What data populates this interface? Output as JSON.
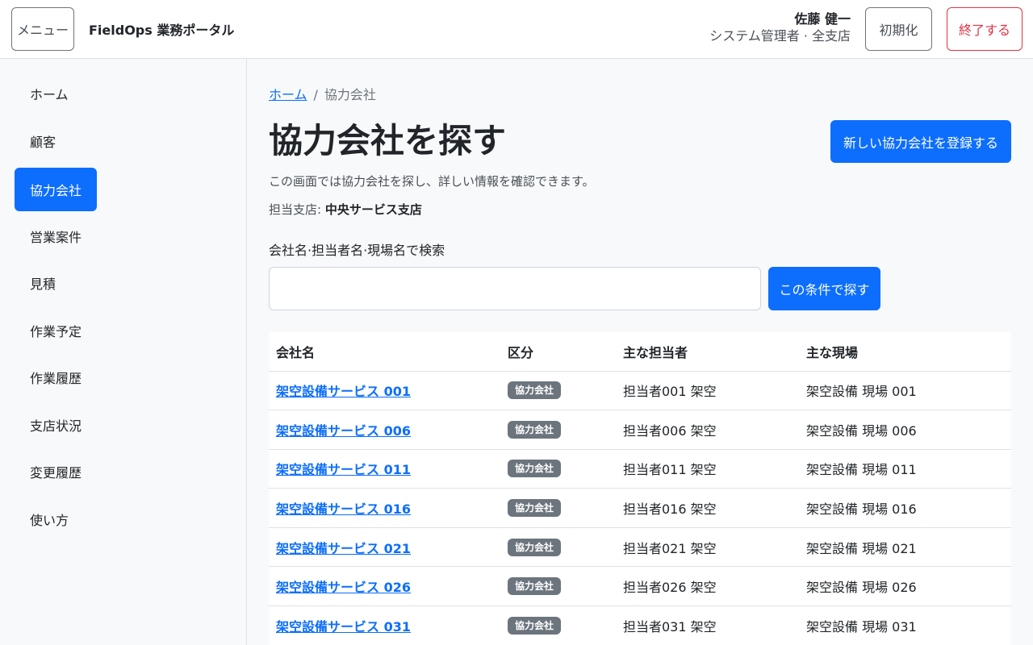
{
  "header": {
    "menu_label": "メニュー",
    "app_title": "FieldOps 業務ポータル",
    "user_name": "佐藤 健一",
    "user_role": "システム管理者 · 全支店",
    "reset_label": "初期化",
    "logout_label": "終了する"
  },
  "sidebar": {
    "items": [
      {
        "label": "ホーム",
        "active": false
      },
      {
        "label": "顧客",
        "active": false
      },
      {
        "label": "協力会社",
        "active": true
      },
      {
        "label": "営業案件",
        "active": false
      },
      {
        "label": "見積",
        "active": false
      },
      {
        "label": "作業予定",
        "active": false
      },
      {
        "label": "作業履歴",
        "active": false
      },
      {
        "label": "支店状況",
        "active": false
      },
      {
        "label": "変更履歴",
        "active": false
      },
      {
        "label": "使い方",
        "active": false
      }
    ]
  },
  "breadcrumb": {
    "home": "ホーム",
    "separator": "/",
    "current": "協力会社"
  },
  "page": {
    "title": "協力会社を探す",
    "description": "この画面では協力会社を探し、詳しい情報を確認できます。",
    "branch_label": "担当支店:",
    "branch_value": "中央サービス支店",
    "register_label": "新しい協力会社を登録する"
  },
  "search": {
    "label": "会社名·担当者名·現場名で検索",
    "value": "",
    "placeholder": "",
    "button_label": "この条件で探す"
  },
  "table": {
    "columns": [
      "会社名",
      "区分",
      "主な担当者",
      "主な現場"
    ],
    "rows": [
      {
        "company": "架空設備サービス 001",
        "category": "協力会社",
        "contact": "担当者001 架空",
        "site": "架空設備 現場 001"
      },
      {
        "company": "架空設備サービス 006",
        "category": "協力会社",
        "contact": "担当者006 架空",
        "site": "架空設備 現場 006"
      },
      {
        "company": "架空設備サービス 011",
        "category": "協力会社",
        "contact": "担当者011 架空",
        "site": "架空設備 現場 011"
      },
      {
        "company": "架空設備サービス 016",
        "category": "協力会社",
        "contact": "担当者016 架空",
        "site": "架空設備 現場 016"
      },
      {
        "company": "架空設備サービス 021",
        "category": "協力会社",
        "contact": "担当者021 架空",
        "site": "架空設備 現場 021"
      },
      {
        "company": "架空設備サービス 026",
        "category": "協力会社",
        "contact": "担当者026 架空",
        "site": "架空設備 現場 026"
      },
      {
        "company": "架空設備サービス 031",
        "category": "協力会社",
        "contact": "担当者031 架空",
        "site": "架空設備 現場 031"
      }
    ]
  }
}
